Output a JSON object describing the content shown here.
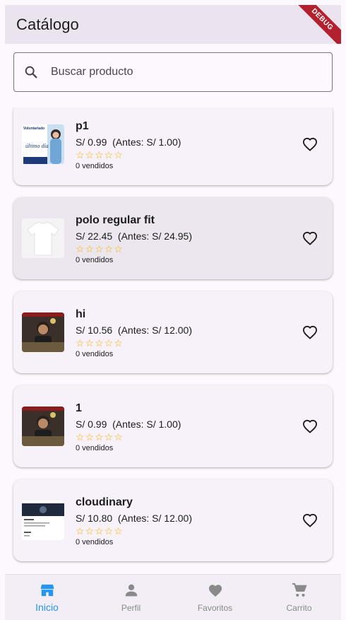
{
  "appbar": {
    "title": "Catálogo",
    "debug_label": "DEBUG"
  },
  "search": {
    "placeholder": "Buscar producto",
    "value": ""
  },
  "products": [
    {
      "name": "p1",
      "price": "S/ 0.99  (Antes: S/ 1.00)",
      "stars": "☆☆☆☆☆",
      "sold": "0 vendidos",
      "thumb_text": "Voluntariado",
      "thumb_text2": "último día"
    },
    {
      "name": "polo regular fit",
      "price": "S/ 22.45  (Antes: S/ 24.95)",
      "stars": "☆☆☆☆☆",
      "sold": "0 vendidos"
    },
    {
      "name": "hi",
      "price": "S/ 10.56  (Antes: S/ 12.00)",
      "stars": "☆☆☆☆☆",
      "sold": "0 vendidos"
    },
    {
      "name": "1",
      "price": "S/ 0.99  (Antes: S/ 1.00)",
      "stars": "☆☆☆☆☆",
      "sold": "0 vendidos"
    },
    {
      "name": "cloudinary",
      "price": "S/ 10.80  (Antes: S/ 12.00)",
      "stars": "☆☆☆☆☆",
      "sold": "0 vendidos"
    }
  ],
  "nav": [
    {
      "label": "Inicio",
      "icon": "store-icon",
      "active": true
    },
    {
      "label": "Perfil",
      "icon": "person-icon"
    },
    {
      "label": "Favoritos",
      "icon": "heart-icon"
    },
    {
      "label": "Carrito",
      "icon": "cart-icon"
    }
  ],
  "colors": {
    "accent": "#2196f3",
    "star": "#f5b301",
    "debug": "#b2212d"
  }
}
